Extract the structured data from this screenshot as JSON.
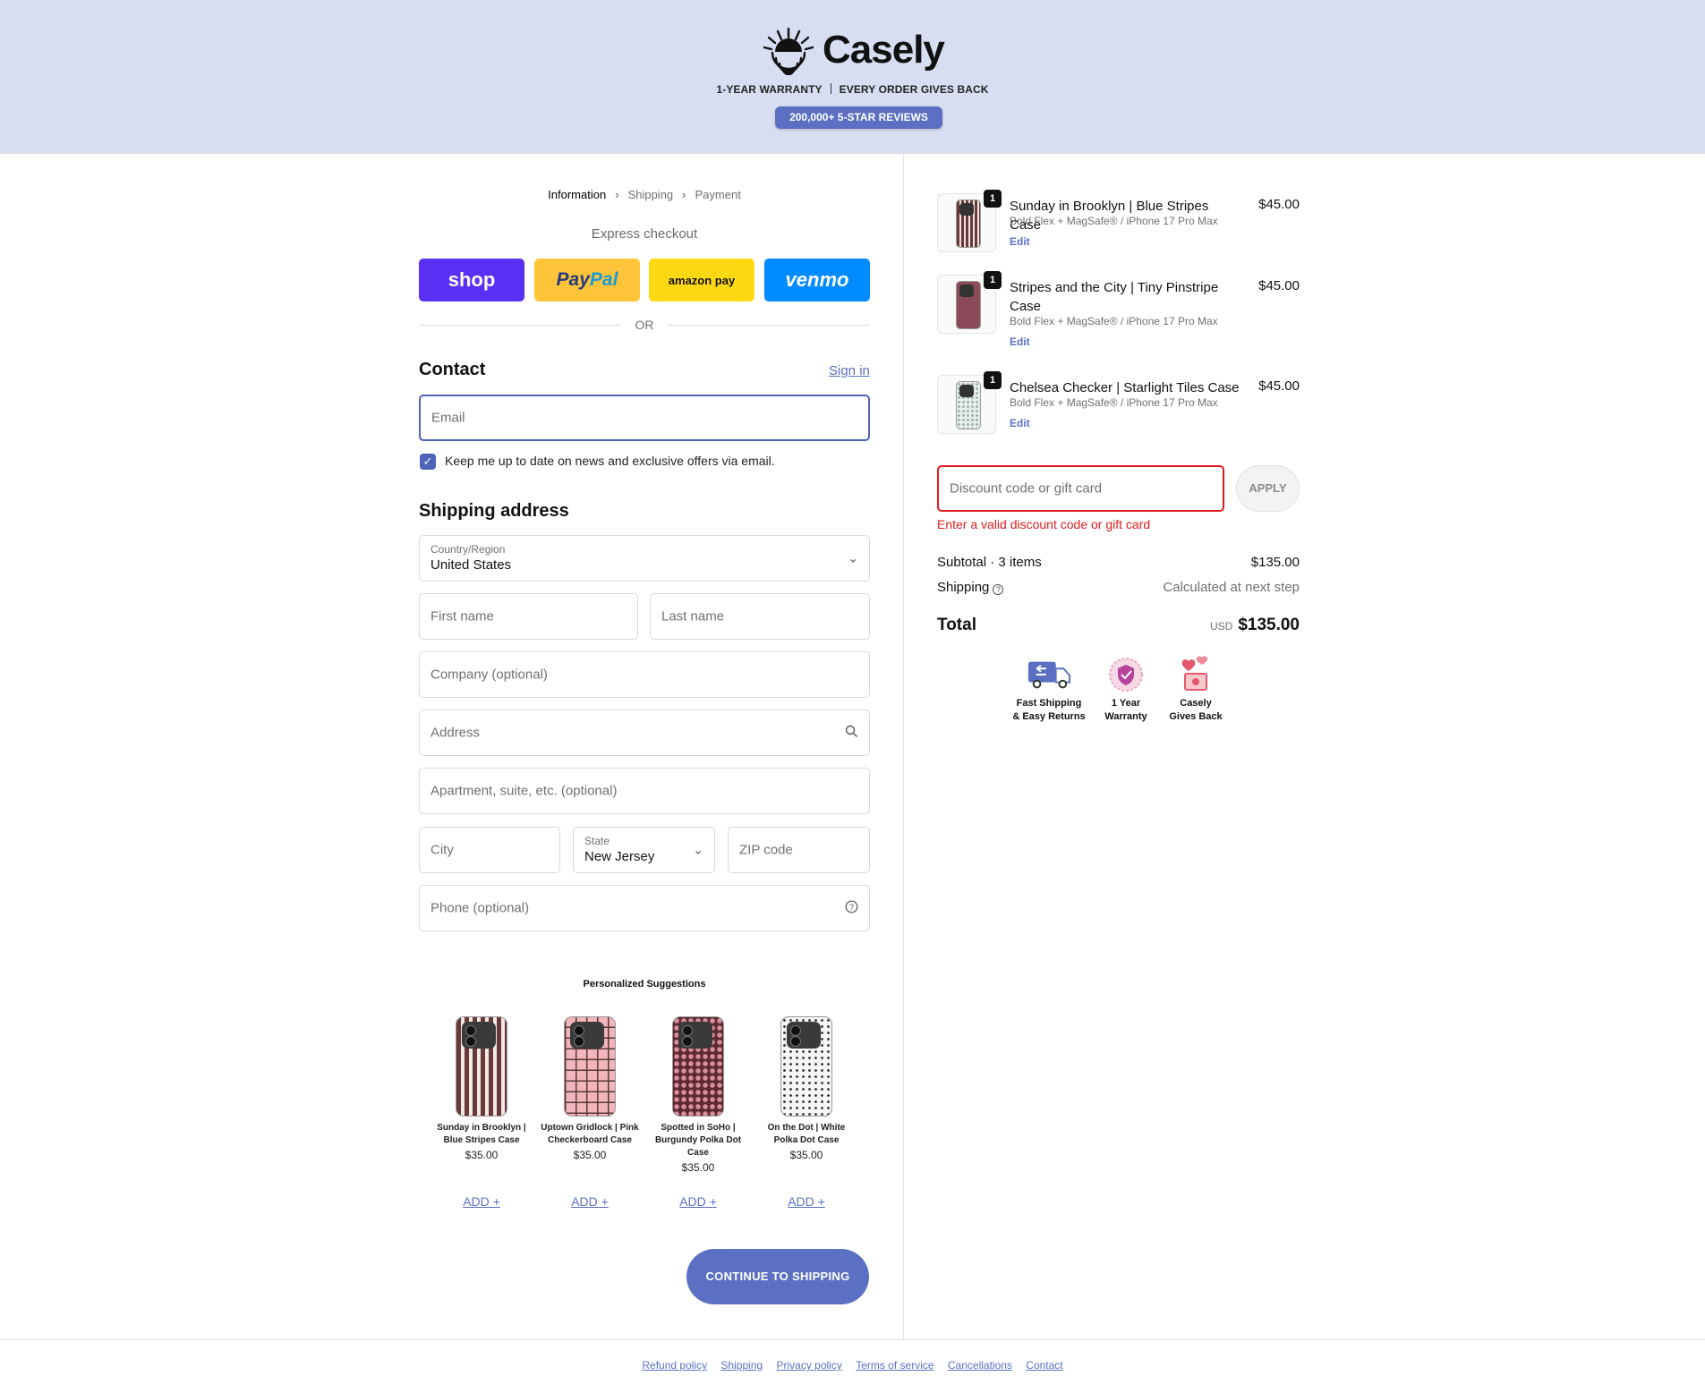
{
  "header": {
    "brand": "Casely",
    "tagline_left": "1-YEAR WARRANTY",
    "tagline_right": "EVERY ORDER GIVES BACK",
    "reviews_badge": "200,000+ 5-STAR REVIEWS",
    "background": "#d8def2",
    "accent": "#5b70c2"
  },
  "breadcrumb": {
    "steps": [
      "Information",
      "Shipping",
      "Payment"
    ],
    "active": "Information"
  },
  "express": {
    "label": "Express checkout",
    "buttons": [
      {
        "name": "shop",
        "label": "shop",
        "color": "#5a31f4"
      },
      {
        "name": "paypal",
        "label_a": "Pay",
        "label_b": "Pal",
        "color": "#ffc439"
      },
      {
        "name": "amazon-pay",
        "label": "amazon pay",
        "color": "#ffd814"
      },
      {
        "name": "venmo",
        "label": "venmo",
        "color": "#008cff"
      }
    ],
    "or_text": "OR"
  },
  "contact": {
    "title": "Contact",
    "signin": "Sign in",
    "email_placeholder": "Email",
    "newsletter_checked": true,
    "newsletter_label": "Keep me up to date on news and exclusive offers via email."
  },
  "shipping": {
    "title": "Shipping address",
    "country_label": "Country/Region",
    "country_value": "United States",
    "first_name": "First name",
    "last_name": "Last name",
    "company": "Company (optional)",
    "address": "Address",
    "apartment": "Apartment, suite, etc. (optional)",
    "city": "City",
    "state_label": "State",
    "state_value": "New Jersey",
    "zip": "ZIP code",
    "phone": "Phone (optional)"
  },
  "suggestions": {
    "title": "Personalized Suggestions",
    "items": [
      {
        "name": "Sunday in Brooklyn | Blue Stripes Case",
        "price": "$35.00",
        "add": "ADD +"
      },
      {
        "name": "Uptown Gridlock | Pink Checkerboard Case",
        "price": "$35.00",
        "add": "ADD +"
      },
      {
        "name": "Spotted in SoHo | Burgundy Polka Dot Case",
        "price": "$35.00",
        "add": "ADD +"
      },
      {
        "name": "On the Dot | White Polka Dot Case",
        "price": "$35.00",
        "add": "ADD +"
      }
    ]
  },
  "continue_button": "CONTINUE TO SHIPPING",
  "footer": {
    "links": [
      "Refund policy",
      "Shipping",
      "Privacy policy",
      "Terms of service",
      "Cancellations",
      "Contact"
    ]
  },
  "cart": {
    "items": [
      {
        "qty": "1",
        "name": "Sunday in Brooklyn | Blue Stripes Case",
        "variant": "Bold Flex + MagSafe® / iPhone 17 Pro Max",
        "price": "$45.00",
        "edit": "Edit"
      },
      {
        "qty": "1",
        "name": "Stripes and the City | Tiny Pinstripe Case",
        "variant": "Bold Flex + MagSafe® / iPhone 17 Pro Max",
        "price": "$45.00",
        "edit": "Edit"
      },
      {
        "qty": "1",
        "name": "Chelsea Checker | Starlight Tiles Case",
        "variant": "Bold Flex + MagSafe® / iPhone 17 Pro Max",
        "price": "$45.00",
        "edit": "Edit"
      }
    ],
    "discount_placeholder": "Discount code or gift card",
    "apply": "APPLY",
    "discount_error": "Enter a valid discount code or gift card",
    "subtotal_label": "Subtotal · 3 items",
    "subtotal_value": "$135.00",
    "shipping_label": "Shipping",
    "shipping_value": "Calculated at next step",
    "total_label": "Total",
    "currency": "USD",
    "total_value": "$135.00",
    "badges": [
      {
        "icon": "truck-icon",
        "line1": "Fast Shipping",
        "line2": "& Easy Returns"
      },
      {
        "icon": "shield-icon",
        "line1": "1 Year",
        "line2": "Warranty"
      },
      {
        "icon": "hearts-icon",
        "line1": "Casely",
        "line2": "Gives Back"
      }
    ]
  }
}
